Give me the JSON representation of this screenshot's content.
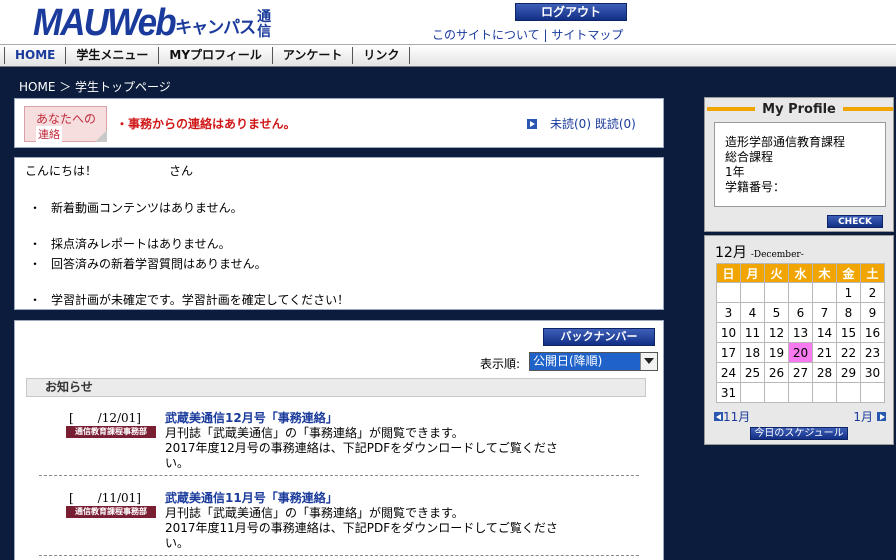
{
  "header": {
    "logo_main": "MAUWeb",
    "logo_sub": "キャンパス",
    "logo_vertical": "通信",
    "logout_label": "ログアウト",
    "about_link": "このサイトについて",
    "sitemap_link": "サイトマップ"
  },
  "nav": {
    "items": [
      {
        "label": "HOME"
      },
      {
        "label": "学生メニュー"
      },
      {
        "label": "MYプロフィール"
      },
      {
        "label": "アンケート"
      },
      {
        "label": "リンク"
      }
    ]
  },
  "breadcrumb": "HOME ＞ 学生トップページ",
  "message": {
    "tag_line1": "あなたへの",
    "tag_line2": "連絡",
    "text": "・事務からの連絡はありません。",
    "unread_label": "未読(0) 既読(0)"
  },
  "greeting": {
    "hello": "こんにちは！　　　　　　さん",
    "bullets": [
      "新着動画コンテンツはありません。",
      "採点済みレポートはありません。",
      "回答済みの新着学習質問はありません。",
      "学習計画が未確定です。学習計画を確定してください！"
    ]
  },
  "news": {
    "back_number_label": "バックナンバー",
    "sort_label": "表示順:",
    "sort_selected": "公開日(降順)",
    "section_title": "お知らせ",
    "items": [
      {
        "date": "[　　/12/01]",
        "tag": "通信教育課程事務部",
        "title": "武蔵美通信12月号「事務連絡」",
        "body": "月刊誌「武蔵美通信」の「事務連絡」が閲覧できます。\n2017年度12月号の事務連絡は、下記PDFをダウンロードしてご覧ください。"
      },
      {
        "date": "[　　/11/01]",
        "tag": "通信教育課程事務部",
        "title": "武蔵美通信11月号「事務連絡」",
        "body": "月刊誌「武蔵美通信」の「事務連絡」が閲覧できます。\n2017年度11月号の事務連絡は、下記PDFをダウンロードしてご覧ください。"
      }
    ]
  },
  "profile": {
    "title": "My Profile",
    "line1": "造形学部通信教育課程",
    "line2": "総合課程",
    "line3": "1年",
    "line4": "学籍番号：",
    "check_label": "CHECK"
  },
  "calendar": {
    "month": "12月",
    "month_en": "-December-",
    "weekdays": [
      "日",
      "月",
      "火",
      "水",
      "木",
      "金",
      "土"
    ],
    "weeks": [
      [
        "",
        "",
        "",
        "",
        "",
        "1",
        "2"
      ],
      [
        "3",
        "4",
        "5",
        "6",
        "7",
        "8",
        "9"
      ],
      [
        "10",
        "11",
        "12",
        "13",
        "14",
        "15",
        "16"
      ],
      [
        "17",
        "18",
        "19",
        "20",
        "21",
        "22",
        "23"
      ],
      [
        "24",
        "25",
        "26",
        "27",
        "28",
        "29",
        "30"
      ],
      [
        "31",
        "",
        "",
        "",
        "",
        "",
        ""
      ]
    ],
    "today": "20",
    "prev_label": "11月",
    "next_label": "1月",
    "schedule_label": "今日のスケジュール",
    "colors": {
      "header": "#f0a500",
      "today": "#f77af0"
    }
  }
}
